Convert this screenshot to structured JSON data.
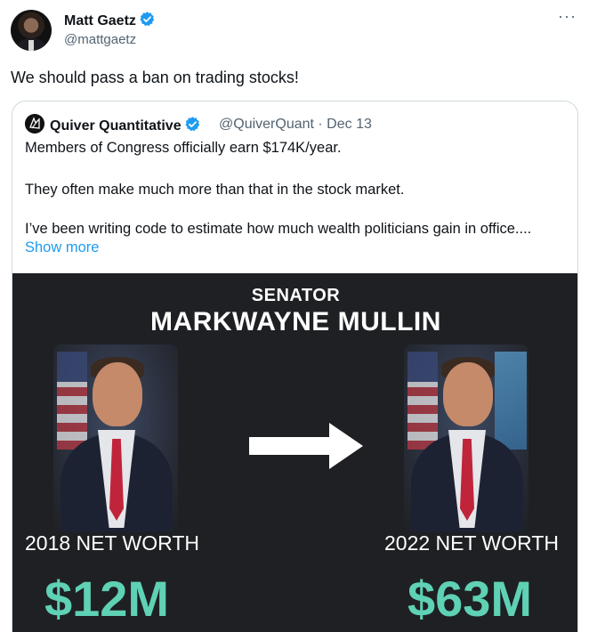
{
  "tweet": {
    "author_name": "Matt Gaetz",
    "author_handle": "@mattgaetz",
    "more_label": "···",
    "text": "We should pass a ban on trading stocks!"
  },
  "quote": {
    "author_name": "Quiver Quantitative",
    "handle_date": "@QuiverQuant · Dec 13",
    "line1": "Members of Congress officially earn $174K/year.",
    "line2": "They often make much more than that in the stock market.",
    "line3": "I’ve been writing code to estimate how much wealth politicians gain in office....",
    "show_more": "Show more"
  },
  "media": {
    "subtitle": "SENATOR",
    "name": "MARKWAYNE MULLIN",
    "left_label": "2018 NET WORTH",
    "left_value": "$12M",
    "right_label": "2022 NET WORTH",
    "right_value": "$63M"
  },
  "colors": {
    "link": "#1d9bf0",
    "verified": "#1d9bf0",
    "accent_value": "#5fd1b4",
    "media_bg": "#1f2024"
  },
  "icons": [
    "verified-badge-icon",
    "more-options-icon",
    "arrow-right-icon"
  ]
}
